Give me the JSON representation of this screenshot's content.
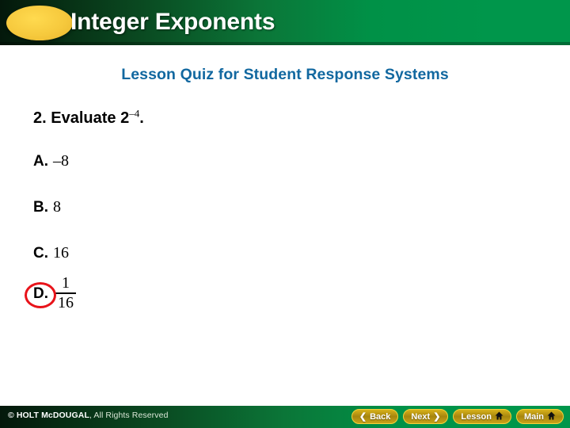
{
  "header": {
    "title": "Integer Exponents",
    "bullet_icon": "yellow-ellipse-icon",
    "band_color": "#00964b",
    "title_color": "#ffffff"
  },
  "subtitle": {
    "text": "Lesson Quiz for Student Response Systems",
    "color": "#1268a0"
  },
  "question": {
    "number": "2.",
    "prompt": "Evaluate",
    "base": "2",
    "exponent": "–4",
    "period": "."
  },
  "choices": [
    {
      "letter": "A.",
      "value": "–8",
      "selected": false
    },
    {
      "letter": "B.",
      "value": "8",
      "selected": false
    },
    {
      "letter": "C.",
      "value": "16",
      "selected": false
    },
    {
      "letter": "D.",
      "value": "1/16",
      "numerator": "1",
      "denominator": "16",
      "selected": true
    }
  ],
  "selection": {
    "marker": "red-circle-annotation",
    "color": "#e8131a",
    "target_letter": "D."
  },
  "footer": {
    "copyright_brand": "© HOLT McDOUGAL",
    "copyright_rest": ", All Rights Reserved",
    "buttons": [
      {
        "label": "Back",
        "icon": "chevron-left-icon",
        "glyph": "❮",
        "icon_side": "left"
      },
      {
        "label": "Next",
        "icon": "chevron-right-icon",
        "glyph": "❯",
        "icon_side": "right"
      },
      {
        "label": "Lesson",
        "icon": "home-icon",
        "glyph": "⌂",
        "icon_side": "right"
      },
      {
        "label": "Main",
        "icon": "home-icon",
        "glyph": "⌂",
        "icon_side": "right"
      }
    ]
  }
}
